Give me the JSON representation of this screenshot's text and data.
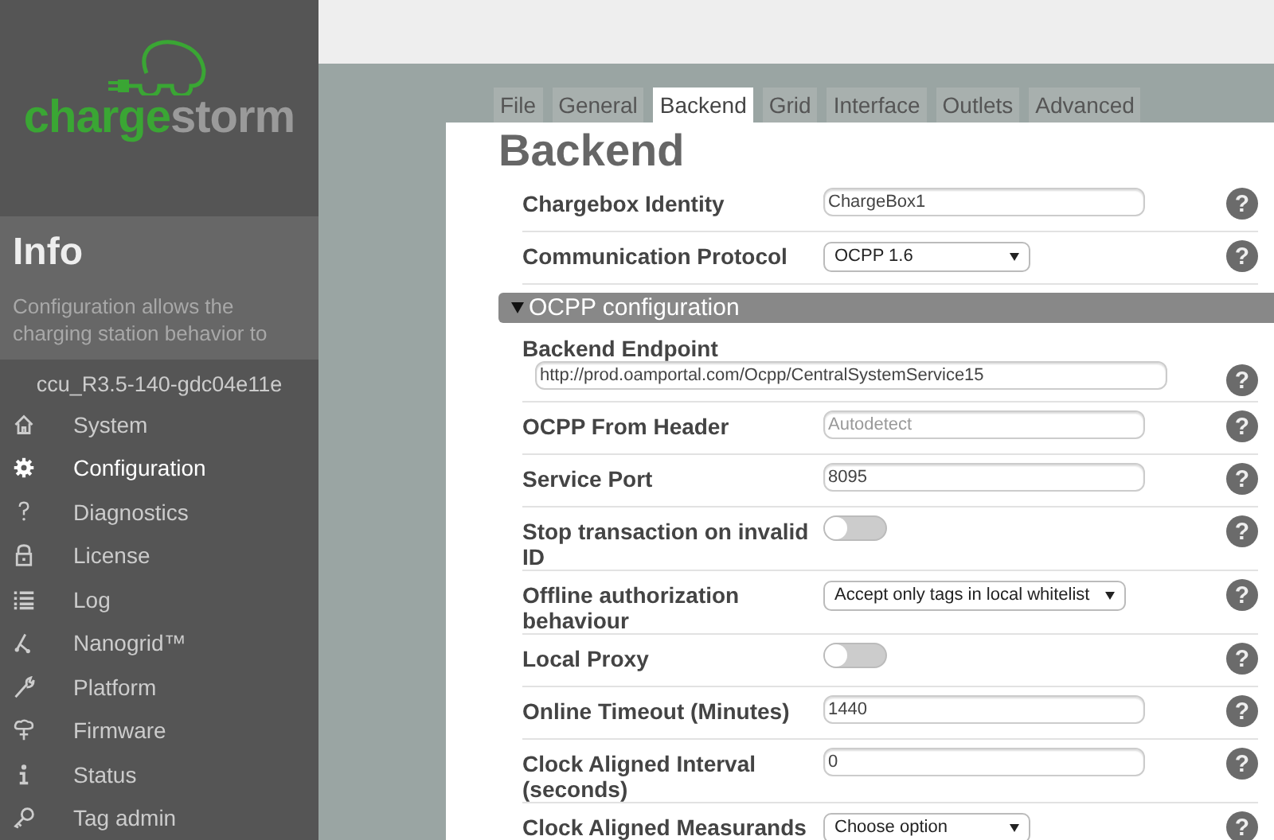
{
  "sidebar": {
    "logo_text": [
      "charge",
      "storm"
    ],
    "info": {
      "title": "Info",
      "description": "Configuration allows the charging station behavior to"
    },
    "version": "ccu_R3.5-140-gdc04e11e",
    "items": [
      {
        "label": "System",
        "selected": false
      },
      {
        "label": "Configuration",
        "selected": true
      },
      {
        "label": "Diagnostics",
        "selected": false
      },
      {
        "label": "License",
        "selected": false
      },
      {
        "label": "Log",
        "selected": false
      },
      {
        "label": "Nanogrid™",
        "selected": false
      },
      {
        "label": "Platform",
        "selected": false
      },
      {
        "label": "Firmware",
        "selected": false
      },
      {
        "label": "Status",
        "selected": false
      },
      {
        "label": "Tag admin",
        "selected": false
      }
    ]
  },
  "tabs": [
    {
      "label": "File",
      "selected": false
    },
    {
      "label": "General",
      "selected": false
    },
    {
      "label": "Backend",
      "selected": true
    },
    {
      "label": "Grid",
      "selected": false
    },
    {
      "label": "Interface",
      "selected": false
    },
    {
      "label": "Outlets",
      "selected": false
    },
    {
      "label": "Advanced",
      "selected": false
    }
  ],
  "page_title": "Backend",
  "rows": [
    {
      "kind": "text",
      "label": "Chargebox Identity",
      "value": "ChargeBox1",
      "help": "?"
    },
    {
      "kind": "select",
      "label": "Communication Protocol",
      "value": "OCPP 1.6",
      "help": "?"
    },
    {
      "kind": "section",
      "label": "OCPP configuration",
      "expanded": true
    },
    {
      "kind": "wide",
      "label": "Backend Endpoint",
      "value": "http://prod.oamportal.com/Ocpp/CentralSystemService15",
      "help": "?"
    },
    {
      "kind": "text",
      "label": "OCPP From Header",
      "placeholder": "Autodetect",
      "help": "?"
    },
    {
      "kind": "text",
      "label": "Service Port",
      "value": "8095",
      "help": "?"
    },
    {
      "kind": "toggle",
      "label": "Stop transaction on invalid ID",
      "on": false,
      "help": "?"
    },
    {
      "kind": "select",
      "label": "Offline authorization behaviour",
      "value": "Accept only tags in local whitelist",
      "help": "?"
    },
    {
      "kind": "toggle",
      "label": "Local Proxy",
      "on": false,
      "help": "?"
    },
    {
      "kind": "text",
      "label": "Online Timeout (Minutes)",
      "value": "1440",
      "help": "?"
    },
    {
      "kind": "text",
      "label": "Clock Aligned Interval (seconds)",
      "value": "0",
      "help": "?"
    },
    {
      "kind": "select",
      "label": "Clock Aligned Measurands",
      "value": "Choose option",
      "help": "?"
    }
  ]
}
